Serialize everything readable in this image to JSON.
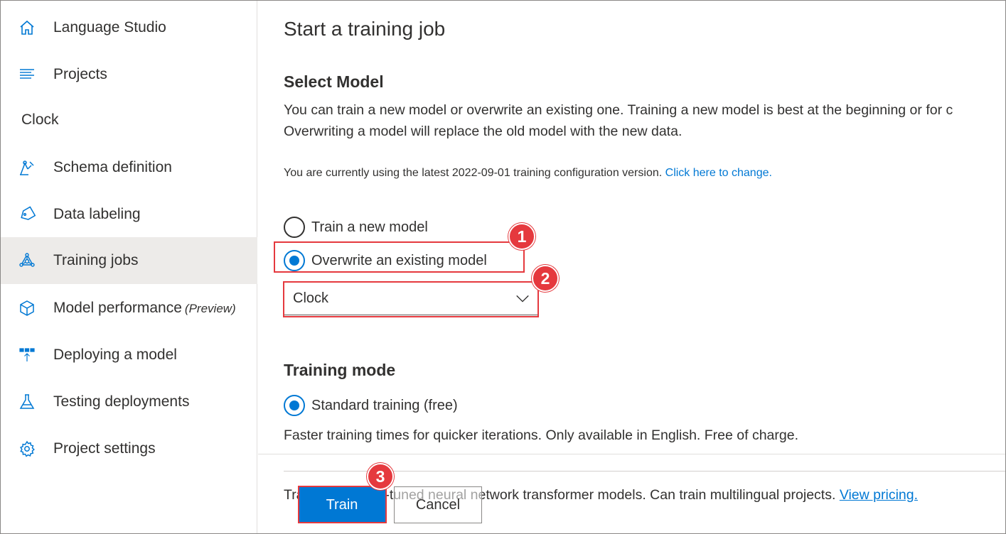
{
  "sidebar": {
    "top_items": [
      {
        "label": "Language Studio",
        "icon": "home-icon"
      },
      {
        "label": "Projects",
        "icon": "projects-list-icon"
      }
    ],
    "project_name": "Clock",
    "items": [
      {
        "label": "Schema definition",
        "icon": "schema-icon"
      },
      {
        "label": "Data labeling",
        "icon": "tag-icon"
      },
      {
        "label": "Training jobs",
        "icon": "training-icon",
        "selected": true
      },
      {
        "label": "Model performance",
        "suffix": "(Preview)",
        "icon": "cube-icon"
      },
      {
        "label": "Deploying a model",
        "icon": "deploy-icon"
      },
      {
        "label": "Testing deployments",
        "icon": "flask-icon"
      },
      {
        "label": "Project settings",
        "icon": "gear-icon"
      }
    ]
  },
  "main": {
    "title": "Start a training job",
    "select_model": {
      "heading": "Select Model",
      "description_line1": "You can train a new model or overwrite an existing one. Training a new model is best at the beginning or for c",
      "description_line2": "Overwriting a model will replace the old model with the new data.",
      "config_note": "You are currently using the latest 2022-09-01 training configuration version.",
      "config_link": "Click here to change.",
      "options": [
        {
          "label": "Train a new model",
          "checked": false
        },
        {
          "label": "Overwrite an existing model",
          "checked": true
        }
      ],
      "dropdown_value": "Clock"
    },
    "training_mode": {
      "heading": "Training mode",
      "option_label": "Standard training (free)",
      "option_checked": true,
      "description": "Faster training times for quicker iterations. Only available in English. Free of charge.",
      "advanced_description": "Trains using fine-tuned neural network transformer models. Can train multilingual projects.",
      "pricing_link": "View pricing."
    },
    "buttons": {
      "train": "Train",
      "cancel": "Cancel"
    }
  },
  "annotations": {
    "step1": "1",
    "step2": "2",
    "step3": "3",
    "highlight_color": "#e5393e"
  },
  "colors": {
    "accent": "#0078d4",
    "selected_bg": "#edebe9"
  }
}
